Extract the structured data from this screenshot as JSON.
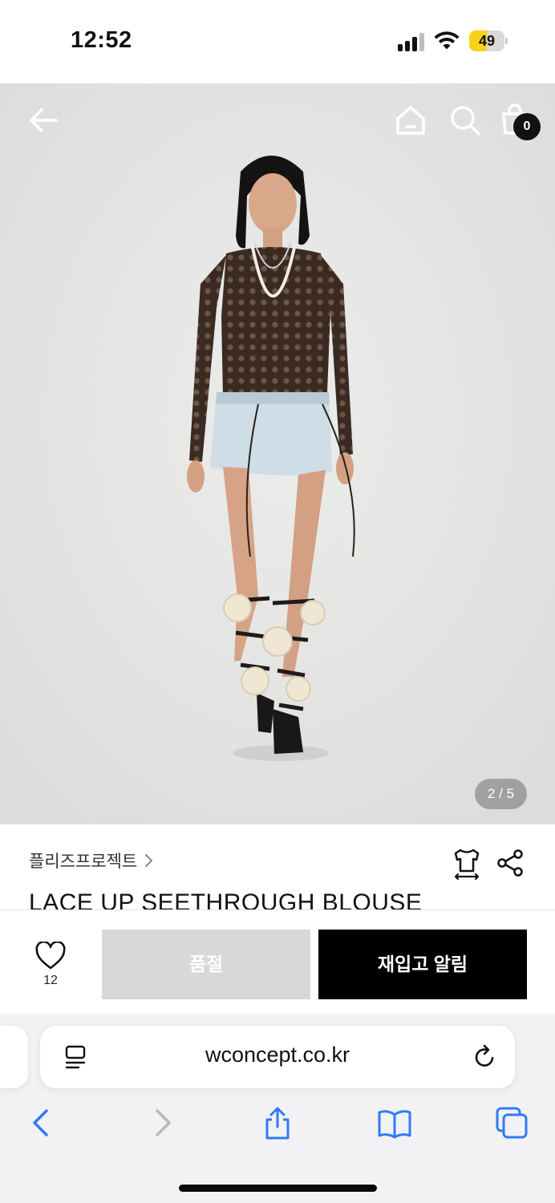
{
  "status_bar": {
    "time": "12:52",
    "battery_percent": "49",
    "battery_level": 0.49,
    "signal_icon": "cellular-signal-icon",
    "wifi_icon": "wifi-icon"
  },
  "hero": {
    "page_indicator": "2 / 5",
    "cart_count": "0",
    "back_icon": "arrow-left-icon",
    "home_icon": "home-icon",
    "search_icon": "search-icon",
    "cart_icon": "shopping-bag-icon"
  },
  "product": {
    "brand": "플리즈프로젝트",
    "title": "LACE UP SEETHROUGH BLOUSE",
    "size_icon": "size-guide-icon",
    "share_icon": "share-icon"
  },
  "purchase_bar": {
    "like_count": "12",
    "like_icon": "heart-icon",
    "soldout_label": "품절",
    "restock_label": "재입고 알림"
  },
  "safari": {
    "url": "wconcept.co.kr",
    "reader_icon": "reader-mode-icon",
    "reload_icon": "reload-icon",
    "toolbar": [
      "back-icon",
      "forward-icon",
      "share-icon",
      "bookmarks-icon",
      "tabs-icon"
    ]
  },
  "colors": {
    "accent_black": "#000000",
    "soldout_gray": "#d8d8d8",
    "battery_yellow": "#f7d21a",
    "safari_blue": "#2f7bf6"
  }
}
